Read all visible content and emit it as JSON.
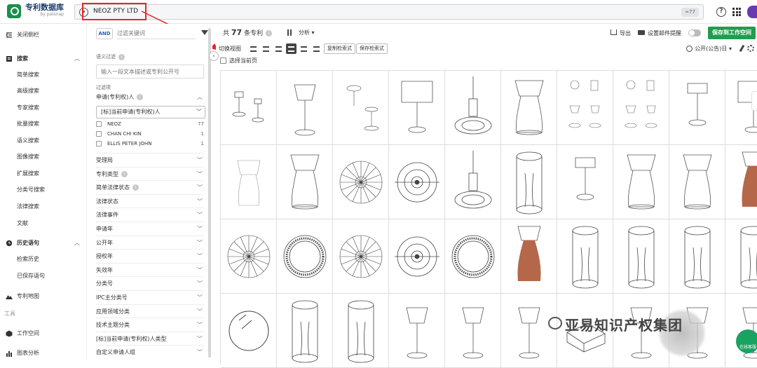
{
  "header": {
    "logo_title": "专利数据库",
    "logo_sub": "by patsnap",
    "search_value": "NEOZ PTY LTD",
    "count_badge": "≈77"
  },
  "sidebar": {
    "collapse_label": "关闭侧栏",
    "search_group": "搜索",
    "search_items": [
      "简单搜索",
      "高级搜索",
      "专家搜索",
      "批量搜索",
      "语义搜索",
      "图像搜索",
      "扩展搜索",
      "分类号搜索",
      "法律搜索",
      "文献"
    ],
    "history_group": "历史语句",
    "history_items": [
      "检索历史",
      "已保存语句"
    ],
    "map_label": "专利地图",
    "tools_section": "工具",
    "workspace_label": "工作空间",
    "chart_label": "图表分析"
  },
  "filter": {
    "and_label": "AND",
    "keyword_placeholder": "过滤关键词",
    "semantic_label": "语义过滤",
    "semantic_placeholder": "输入一段文本描述或专利公开号",
    "filter_items_label": "过滤项",
    "applicant_group": "申请(专利权)人",
    "applicant_select": "[标]当前申请(专利权)人",
    "applicants": [
      {
        "name": "NEOZ",
        "count": "77"
      },
      {
        "name": "CHAN CHI KIN",
        "count": "1"
      },
      {
        "name": "ELLIS PETER JOHN",
        "count": "1"
      }
    ],
    "groups": [
      "受理局",
      "专利类型",
      "简单法律状态",
      "法律状态",
      "法律事件",
      "申请年",
      "公开年",
      "授权年",
      "失效年",
      "分类号",
      "IPC主分类号",
      "应用领域分类",
      "技术主题分类",
      "[标]当前申请(专利权)人类型",
      "自定义申请人组"
    ]
  },
  "toolbar": {
    "total_prefix": "共",
    "total_count": "77",
    "total_suffix": "条专利",
    "analysis": "分析",
    "export": "导出",
    "mail_alert": "设置邮件提醒",
    "save_workspace": "保存到工作空间",
    "view_label": "切换视图",
    "copy_query": "复制检索式",
    "save_query": "保存检索式",
    "sort": "公开(公告)日",
    "select_current": "选择当前页"
  },
  "watermark": {
    "text": "亚易知识产权集团",
    "chat": "在线客服"
  },
  "colors": {
    "accent_green": "#1e9e4e",
    "highlight_red": "#e22222",
    "wood": "#b5674a"
  },
  "thumbnails": [
    "lamp-pair",
    "lamp-tall",
    "lamp-assembly",
    "lamp-shade",
    "lamp-exploded",
    "lamp-cone",
    "lamp-views",
    "lamp-views",
    "lamp-small",
    "lamp-shade",
    "lamp-sketch",
    "lamp-cone",
    "disc-radial",
    "disc-target",
    "lamp-exploded",
    "cylinder",
    "lamp-small",
    "lamp-cone",
    "lamp-cone",
    "lamp-wood",
    "disc-radial",
    "disc-ring",
    "disc-radial",
    "disc-target",
    "disc-ring",
    "lamp-wood",
    "cylinder",
    "cylinder",
    "cylinder",
    "cylinder",
    "disc-plain",
    "cylinder",
    "cylinder",
    "lamp-tall",
    "lamp-tall",
    "lamp-tall",
    "lamp-box",
    "lamp-tall",
    "lamp-tall",
    "lamp-tall"
  ]
}
